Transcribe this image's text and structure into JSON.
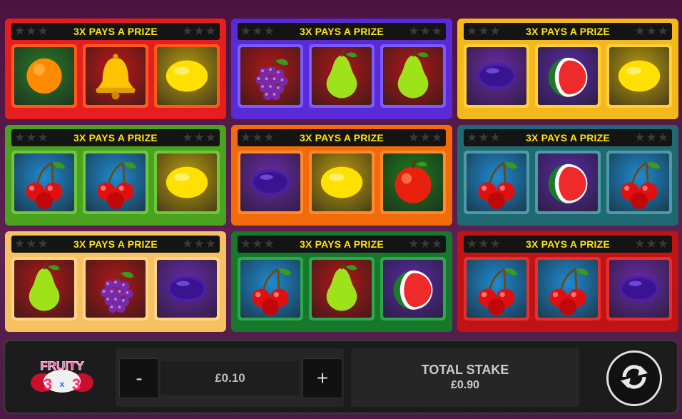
{
  "game": {
    "logo": "FRUITY 3x3",
    "banner_text": "3X PAYS A PRIZE"
  },
  "cards": [
    {
      "name": "card-1",
      "color": "#e61e1e",
      "tile_color": "#ff5a1e",
      "symbols": [
        "orange",
        "bell",
        "lemon"
      ]
    },
    {
      "name": "card-2",
      "color": "#5a2ad6",
      "tile_color": "#7a5cff",
      "symbols": [
        "grapes",
        "pear",
        "pear"
      ]
    },
    {
      "name": "card-3",
      "color": "#f5b81c",
      "tile_color": "#ffcf3c",
      "symbols": [
        "plum",
        "watermelon",
        "lemon"
      ]
    },
    {
      "name": "card-4",
      "color": "#4aa21e",
      "tile_color": "#6ec83a",
      "symbols": [
        "cherry",
        "cherry",
        "lemon"
      ]
    },
    {
      "name": "card-5",
      "color": "#f26a0a",
      "tile_color": "#ff8a2a",
      "symbols": [
        "plum",
        "lemon",
        "apple"
      ]
    },
    {
      "name": "card-6",
      "color": "#1f6a72",
      "tile_color": "#4e9aa6",
      "symbols": [
        "cherry",
        "watermelon",
        "cherry"
      ]
    },
    {
      "name": "card-7",
      "color": "#f7c060",
      "tile_color": "#ffd58a",
      "symbols": [
        "pear",
        "grapes",
        "plum"
      ]
    },
    {
      "name": "card-8",
      "color": "#16782a",
      "tile_color": "#2ea84a",
      "symbols": [
        "cherry",
        "pear",
        "watermelon"
      ]
    },
    {
      "name": "card-9",
      "color": "#c01414",
      "tile_color": "#e63030",
      "symbols": [
        "cherry",
        "cherry",
        "plum"
      ]
    }
  ],
  "controls": {
    "minus_label": "-",
    "plus_label": "+",
    "stake_value": "£0.10",
    "total_label": "TOTAL STAKE",
    "total_value": "£0.90"
  },
  "icons": {
    "spin": "refresh-icon",
    "star": "star-icon"
  }
}
